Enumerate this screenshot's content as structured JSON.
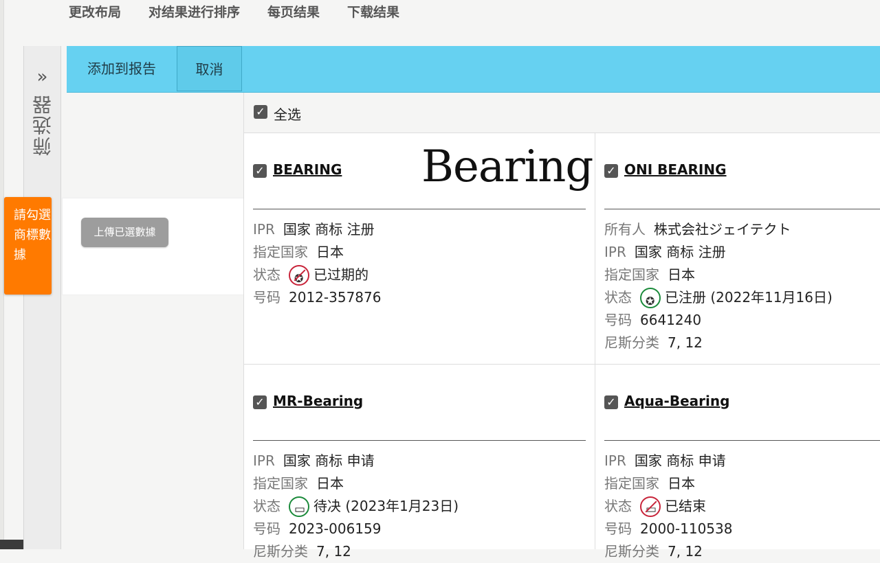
{
  "topmenu": {
    "items": [
      "更改布局",
      "对结果进行排序",
      "每页结果",
      "下载结果"
    ]
  },
  "filter_rail": {
    "label": "筛选器",
    "chevron": "»"
  },
  "orange_tab": {
    "text": "請勾選商標數據"
  },
  "upload": {
    "button_label": "上傳已選數據"
  },
  "actionbar": {
    "add_label": "添加到报告",
    "cancel_label": "取消"
  },
  "select_all": {
    "label": "全选",
    "checked": true
  },
  "cards": [
    {
      "title": "BEARING",
      "logo_text": "Bearing",
      "checked": true,
      "fields": [
        {
          "k": "IPR",
          "v": "国家 商标 注册"
        },
        {
          "k": "指定国家",
          "v": "日本"
        },
        {
          "k": "状态",
          "v": "已过期的",
          "icon": "expired-icon"
        },
        {
          "k": "号码",
          "v": "2012-357876"
        }
      ]
    },
    {
      "title": "ONI BEARING",
      "logo_text": "",
      "checked": true,
      "fields": [
        {
          "k": "所有人",
          "v": "株式会社ジェイテクト"
        },
        {
          "k": "IPR",
          "v": "国家 商标 注册"
        },
        {
          "k": "指定国家",
          "v": "日本"
        },
        {
          "k": "状态",
          "v": "已注册 (2022年11月16日)",
          "icon": "registered-icon"
        },
        {
          "k": "号码",
          "v": "6641240"
        },
        {
          "k": "尼斯分类",
          "v": "7, 12"
        }
      ]
    },
    {
      "title": "MR-Bearing",
      "logo_text": "",
      "checked": true,
      "fields": [
        {
          "k": "IPR",
          "v": "国家 商标 申请"
        },
        {
          "k": "指定国家",
          "v": "日本"
        },
        {
          "k": "状态",
          "v": "待决 (2023年1月23日)",
          "icon": "pending-icon"
        },
        {
          "k": "号码",
          "v": "2023-006159"
        },
        {
          "k": "尼斯分类",
          "v": "7, 12"
        }
      ]
    },
    {
      "title": "Aqua‐Bearing",
      "logo_text": "",
      "checked": true,
      "fields": [
        {
          "k": "IPR",
          "v": "国家 商标 申请"
        },
        {
          "k": "指定国家",
          "v": "日本"
        },
        {
          "k": "状态",
          "v": "已结束",
          "icon": "ended-icon"
        },
        {
          "k": "号码",
          "v": "2000-110538"
        },
        {
          "k": "尼斯分类",
          "v": "7, 12"
        }
      ]
    }
  ],
  "colors": {
    "actionbar": "#66d1f1",
    "orange_tab": "#ff7a00",
    "expired": "#c8243a",
    "registered": "#1a8a3a"
  }
}
